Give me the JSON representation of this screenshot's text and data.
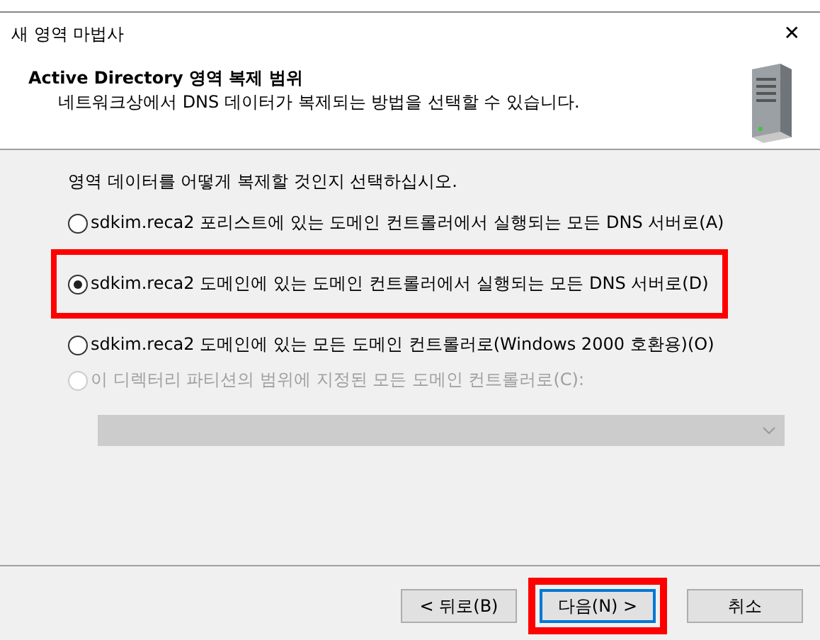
{
  "window": {
    "title": "새 영역 마법사",
    "close": "✕"
  },
  "header": {
    "title": "Active Directory 영역 복제 범위",
    "subtitle": "네트워크상에서 DNS 데이터가 복제되는 방법을 선택할 수 있습니다."
  },
  "prompt": "영역 데이터를 어떻게 복제할 것인지 선택하십시오.",
  "options": [
    {
      "label": "sdkim.reca2 포리스트에 있는 도메인 컨트롤러에서 실행되는 모든 DNS 서버로(A)",
      "selected": false,
      "disabled": false,
      "highlighted": false
    },
    {
      "label": "sdkim.reca2 도메인에 있는 도메인 컨트롤러에서 실행되는 모든 DNS 서버로(D)",
      "selected": true,
      "disabled": false,
      "highlighted": true
    },
    {
      "label": "sdkim.reca2 도메인에 있는 모든 도메인 컨트롤러로(Windows 2000 호환용)(O)",
      "selected": false,
      "disabled": false,
      "highlighted": false
    },
    {
      "label": "이 디렉터리 파티션의 범위에 지정된 모든 도메인 컨트롤러로(C):",
      "selected": false,
      "disabled": true,
      "highlighted": false
    }
  ],
  "partition_dropdown": {
    "disabled": true
  },
  "buttons": [
    {
      "label": "< 뒤로(B)",
      "default": false,
      "highlighted": false
    },
    {
      "label": "다음(N) >",
      "default": true,
      "highlighted": true
    },
    {
      "label": "취소",
      "default": false,
      "highlighted": false
    }
  ]
}
